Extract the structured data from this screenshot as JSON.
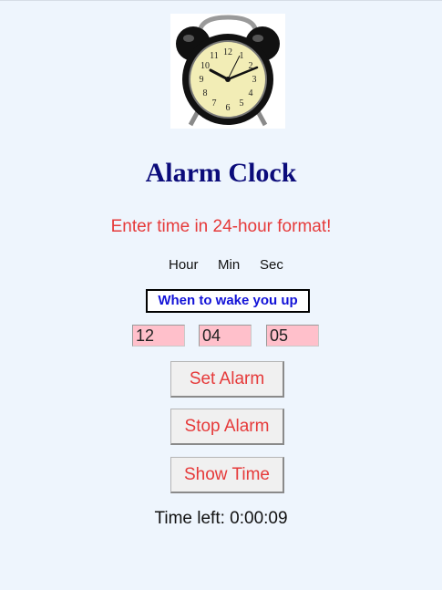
{
  "app": {
    "title": "Alarm Clock",
    "instruction": "Enter time in 24-hour format!"
  },
  "image": {
    "icon": "alarm-clock-icon",
    "alt": "Alarm clock"
  },
  "labels": {
    "hour": "Hour",
    "min": "Min",
    "sec": "Sec"
  },
  "wake_label": "When to wake you up",
  "inputs": {
    "hour": "12",
    "min": "04",
    "sec": "05"
  },
  "buttons": {
    "set": "Set Alarm",
    "stop": "Stop Alarm",
    "show": "Show Time"
  },
  "status": {
    "time_left": "Time left: 0:00:09"
  },
  "colors": {
    "background": "#eef5fd",
    "title": "#0b0b7a",
    "accent": "#e63a3a",
    "wake_text": "#1313d8",
    "input_bg": "#ffc0cb"
  }
}
